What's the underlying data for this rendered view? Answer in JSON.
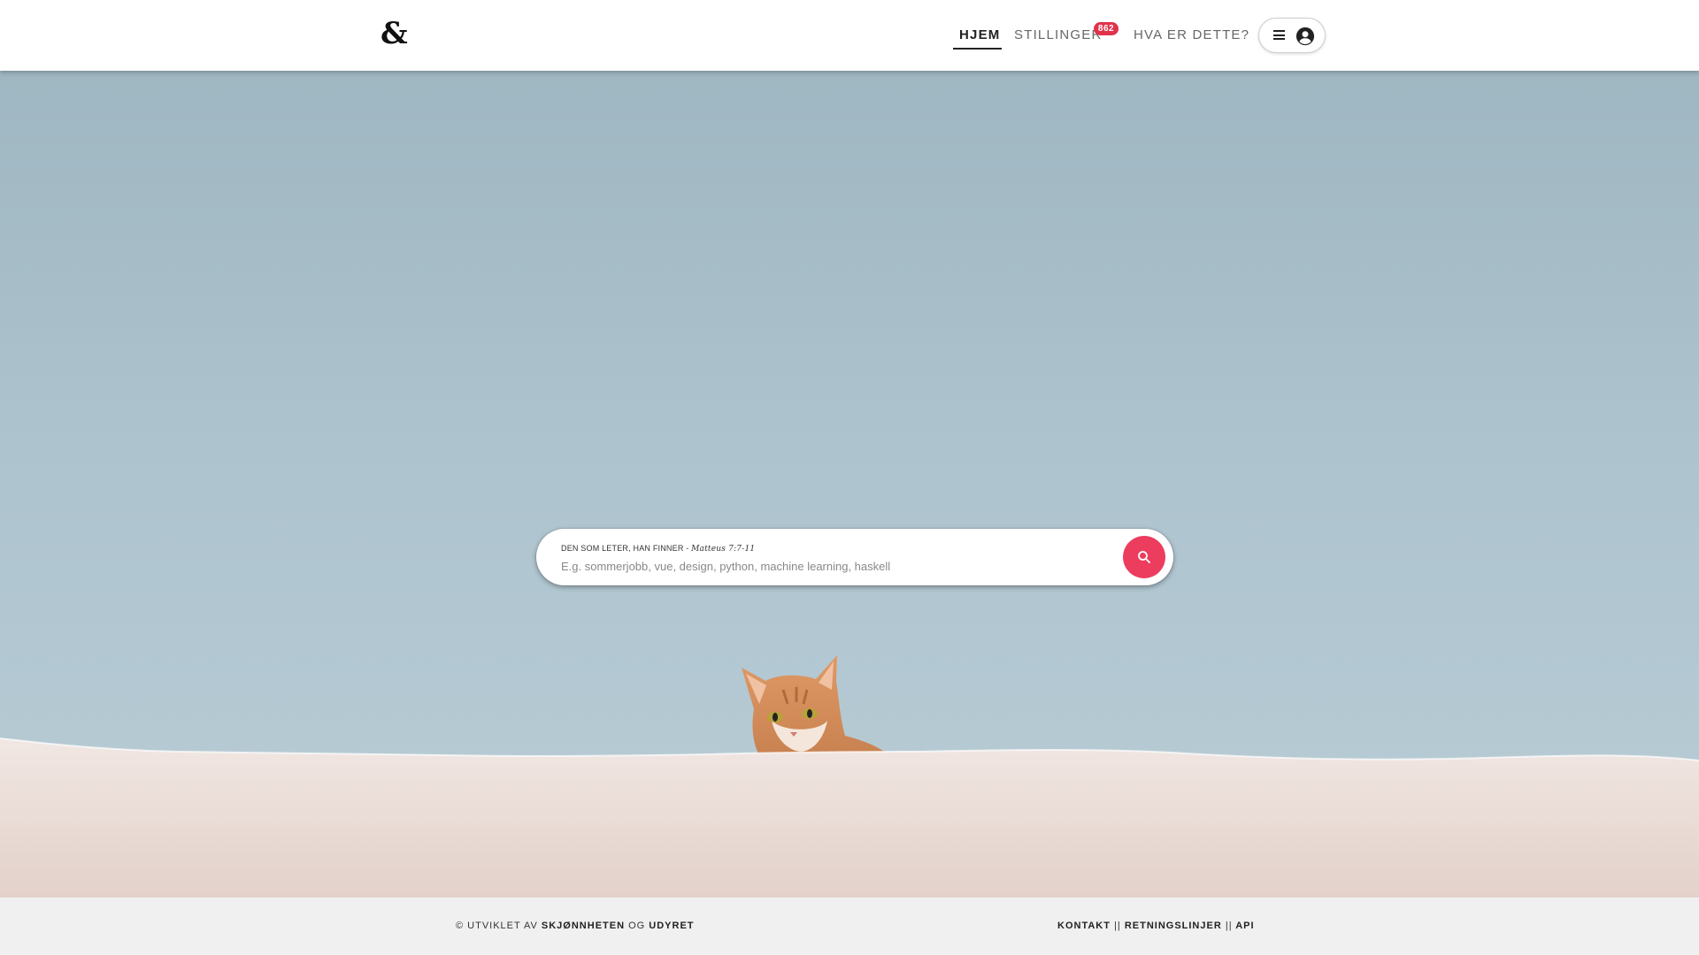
{
  "header": {
    "logo": "&",
    "nav": {
      "home": "HJEM",
      "jobs": "STILLINGER",
      "jobs_badge": "862",
      "about": "HVA ER DETTE?"
    }
  },
  "search": {
    "label": "DEN SOM LETER, HAN FINNER - ",
    "label_citation": "Matteus 7:7-11",
    "placeholder": "E.g. sommerjobb, vue, design, python, machine learning, haskell",
    "value": ""
  },
  "footer": {
    "copyright_prefix": "© UTVIKLET AV",
    "author_1": "SKJØNNHETEN",
    "conjunction": "OG",
    "author_2": "UDYRET",
    "links": [
      "KONTAKT",
      "RETNINGSLINJER",
      "API"
    ],
    "separator": "||"
  },
  "colors": {
    "accent": "#ec3d5e",
    "badge": "#e0334b",
    "sky": "#aec4ce",
    "wall": "#ede2dd",
    "cat": "#d88e58"
  },
  "icons": [
    "menu-icon",
    "account-circle-icon",
    "search-icon"
  ]
}
